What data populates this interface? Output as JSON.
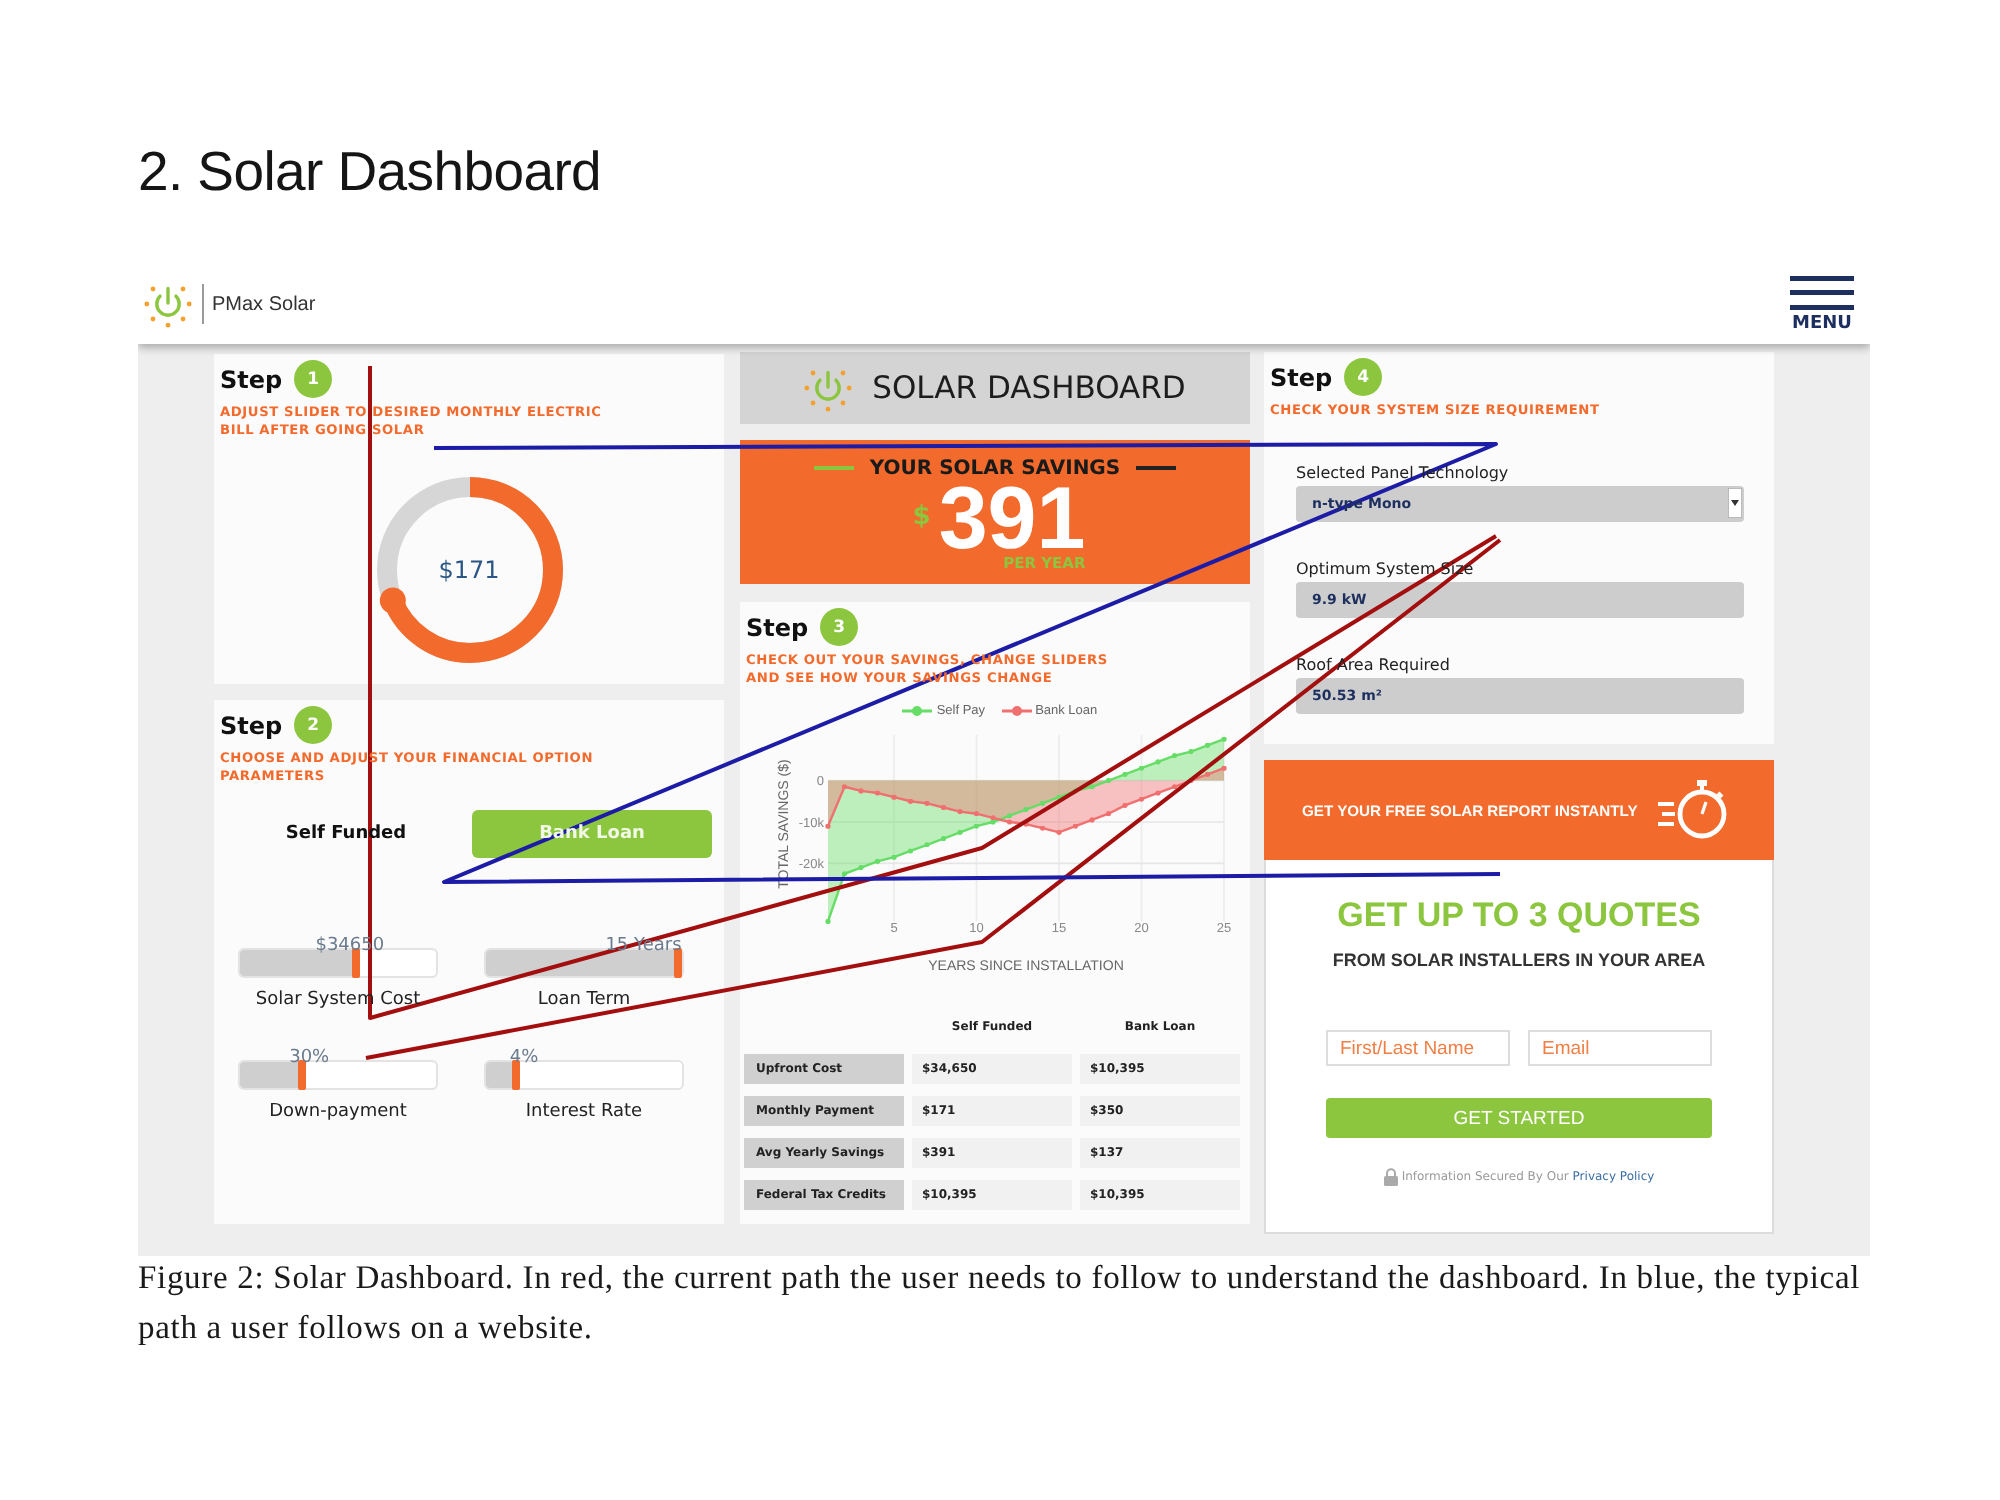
{
  "heading": "2. Solar Dashboard",
  "navbar": {
    "brand": "PMax Solar",
    "menu_label": "MENU"
  },
  "step1": {
    "label": "Step",
    "number": "1",
    "instruction": "ADJUST SLIDER TO DESIRED MONTHLY ELECTRIC BILL AFTER GOING SOLAR",
    "bill_slider": {
      "level": 0.69,
      "reading": "$171"
    }
  },
  "step2": {
    "label": "Step",
    "number": "2",
    "instruction": "CHOOSE AND ADJUST YOUR FINANCIAL OPTION PARAMETERS",
    "options": [
      {
        "label": "Self Funded",
        "selected": false
      },
      {
        "label": "Bank Loan",
        "selected": true
      }
    ],
    "sliders": [
      {
        "name": "Solar System Cost",
        "reading": "$34650",
        "level": 0.59
      },
      {
        "name": "Loan Term",
        "reading": "15 Years",
        "level": 0.98
      },
      {
        "name": "Down-payment",
        "reading": "30%",
        "level": 0.32
      },
      {
        "name": "Interest Rate",
        "reading": "4%",
        "level": 0.15
      }
    ]
  },
  "title_bar": {
    "title": "SOLAR DASHBOARD"
  },
  "savings": {
    "heading": "YOUR SOLAR SAVINGS",
    "currency": "$",
    "amount": "391",
    "period": "PER YEAR"
  },
  "step3": {
    "label": "Step",
    "number": "3",
    "instruction": "CHECK OUT YOUR SAVINGS, CHANGE SLIDERS AND SEE HOW YOUR SAVINGS CHANGE",
    "chart_data": {
      "type": "area",
      "xlabel": "YEARS SINCE INSTALLATION",
      "ylabel": "TOTAL SAVINGS ($)",
      "x": [
        1,
        2,
        3,
        4,
        5,
        6,
        7,
        8,
        9,
        10,
        11,
        12,
        13,
        14,
        15,
        16,
        17,
        18,
        19,
        20,
        21,
        22,
        23,
        24,
        25
      ],
      "series": [
        {
          "name": "Self Pay",
          "color": "#66dd66",
          "values": [
            -34000,
            -22500,
            -21000,
            -19500,
            -18500,
            -17000,
            -15500,
            -14000,
            -12500,
            -11000,
            -10000,
            -8500,
            -7000,
            -5500,
            -4000,
            -2500,
            -1500,
            0,
            1500,
            3000,
            4500,
            6000,
            7000,
            8500,
            10000
          ]
        },
        {
          "name": "Bank Loan",
          "color": "#f07070",
          "values": [
            -11000,
            -1500,
            -2500,
            -3000,
            -4000,
            -5000,
            -5500,
            -6500,
            -7500,
            -8000,
            -9000,
            -10000,
            -10500,
            -11500,
            -12500,
            -11000,
            -9500,
            -8000,
            -6000,
            -4500,
            -3000,
            -1500,
            0,
            1500,
            3000
          ]
        }
      ],
      "xlim": [
        1,
        25
      ],
      "ylim": [
        -34000,
        11000
      ],
      "xticks": [
        5,
        10,
        15,
        20,
        25
      ],
      "yticks": [
        {
          "value": 0,
          "label": "0"
        },
        {
          "value": -10000,
          "label": "-10k"
        },
        {
          "value": -20000,
          "label": "-20k"
        }
      ],
      "grid": true,
      "legend": "top"
    },
    "table": {
      "columns": [
        "Self Funded",
        "Bank Loan"
      ],
      "rows": [
        {
          "label": "Upfront Cost",
          "cells": [
            "$34,650",
            "$10,395"
          ]
        },
        {
          "label": "Monthly Payment",
          "cells": [
            "$171",
            "$350"
          ]
        },
        {
          "label": "Avg Yearly Savings",
          "cells": [
            "$391",
            "$137"
          ]
        },
        {
          "label": "Federal Tax Credits",
          "cells": [
            "$10,395",
            "$10,395"
          ]
        }
      ]
    }
  },
  "step4": {
    "label": "Step",
    "number": "4",
    "instruction": "CHECK YOUR SYSTEM SIZE REQUIREMENT",
    "fields": [
      {
        "kind": "select",
        "label": "Selected Panel Technology",
        "value": "n-type Mono"
      },
      {
        "kind": "readout",
        "label": "Optimum System Size",
        "value": "9.9 kW"
      },
      {
        "kind": "readout",
        "label": "Roof Area Required",
        "value": "50.53 m²"
      }
    ]
  },
  "report_banner": {
    "text": "GET YOUR FREE SOLAR REPORT INSTANTLY"
  },
  "quote_form": {
    "title": "GET UP TO 3 QUOTES",
    "subtitle": "FROM SOLAR INSTALLERS IN YOUR AREA",
    "inputs": [
      {
        "placeholder": "First/Last Name"
      },
      {
        "placeholder": "Email"
      }
    ],
    "button": "GET STARTED",
    "privacy_note": "Information Secured By Our",
    "privacy_link": "Privacy Policy"
  },
  "overlay_paths": [
    {
      "color": "#a30e0e"
    },
    {
      "color": "#a30e0e"
    },
    {
      "color": "#1c1ca6"
    }
  ],
  "caption": "Figure 2: Solar Dashboard. In red, the current path the user needs to follow to understand the dashboard. In blue, the typical path a user follows on a website."
}
